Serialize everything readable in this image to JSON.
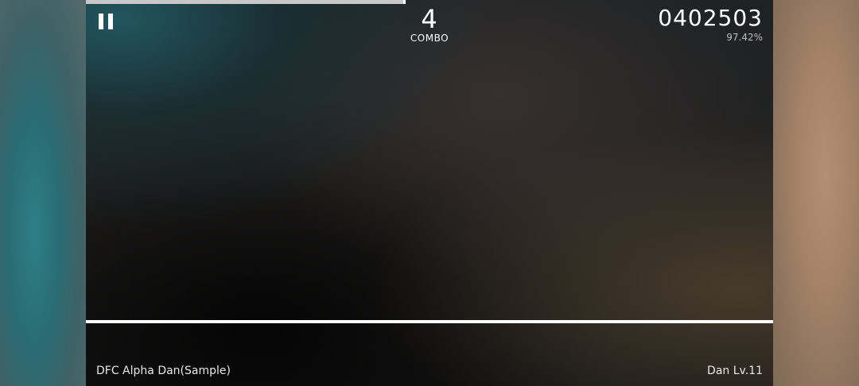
{
  "hud": {
    "combo_value": "4",
    "combo_label": "COMBO",
    "score": "0402503",
    "accuracy": "97.42%",
    "song_progress": 0.465,
    "pause_icon": "pause-icon"
  },
  "footer": {
    "song_title": "DFC Alpha Dan(Sample)",
    "level": "Dan Lv.11"
  },
  "colors": {
    "progress_fill": "#c8c8c8",
    "judge_line": "#ffffff",
    "text_primary": "#ffffff",
    "text_secondary": "#bdbdbd"
  }
}
